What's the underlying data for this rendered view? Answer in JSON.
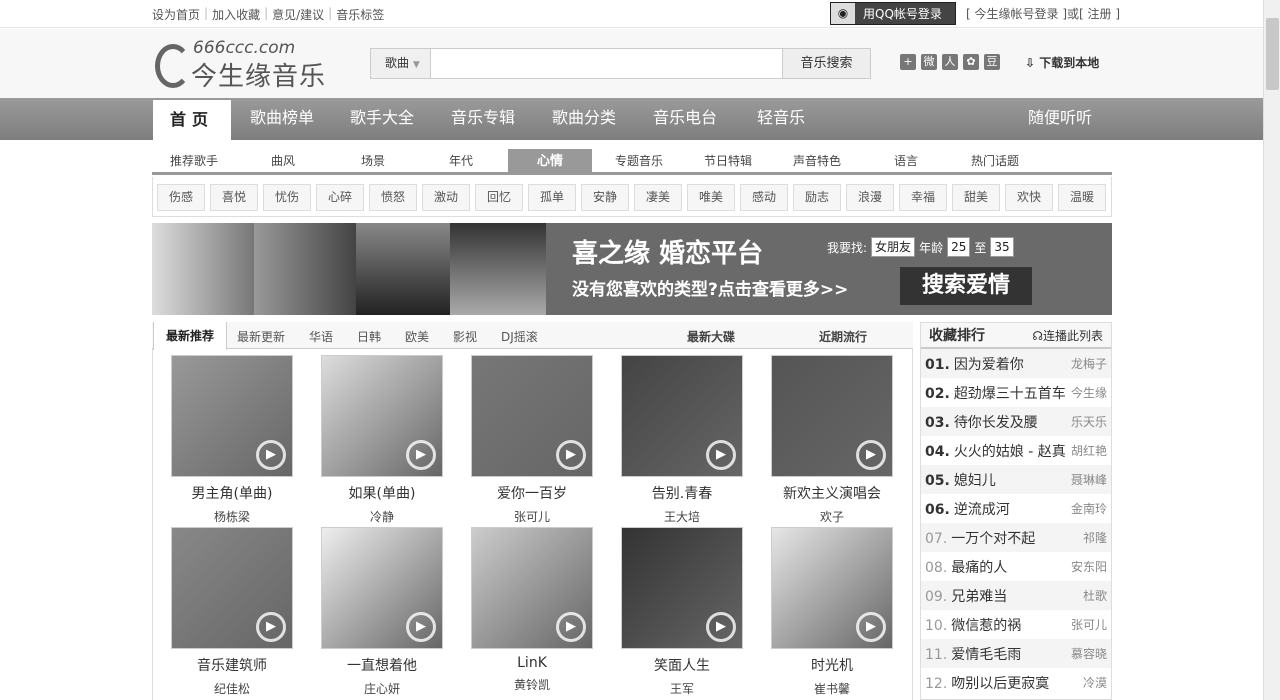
{
  "topbar": {
    "links": [
      "设为首页",
      "加入收藏",
      "意见/建议",
      "音乐标签"
    ],
    "qq_login": "用QQ帐号登录",
    "account_login": "今生缘帐号登录",
    "or": "或",
    "register": "注册"
  },
  "logo": {
    "domain": "666ccc.com",
    "name": "今生缘音乐"
  },
  "search": {
    "category": "歌曲",
    "placeholder": "",
    "button": "音乐搜索"
  },
  "share_icons": [
    "plus-icon",
    "weibo-icon",
    "renren-icon",
    "baidu-icon",
    "douban-icon"
  ],
  "download": "下载到本地",
  "nav": [
    "首页",
    "歌曲榜单",
    "歌手大全",
    "音乐专辑",
    "歌曲分类",
    "音乐电台",
    "轻音乐",
    "随便听听"
  ],
  "subnav": [
    "推荐歌手",
    "曲风",
    "场景",
    "年代",
    "心情",
    "专题音乐",
    "节日特辑",
    "声音特色",
    "语言",
    "热门话题"
  ],
  "moods": [
    "伤感",
    "喜悦",
    "忧伤",
    "心碎",
    "愤怒",
    "激动",
    "回忆",
    "孤单",
    "安静",
    "凄美",
    "唯美",
    "感动",
    "励志",
    "浪漫",
    "幸福",
    "甜美",
    "欢快",
    "温暖"
  ],
  "banner": {
    "title": "喜之缘 婚恋平台",
    "subtitle": "没有您喜欢的类型?点击查看更多>>",
    "find_label": "我要找:",
    "find_value": "女朋友",
    "age_label": "年龄",
    "age_from": "25",
    "to": "至",
    "age_to": "35",
    "button": "搜索爱情"
  },
  "tabs": [
    "最新推荐",
    "最新更新",
    "华语",
    "日韩",
    "欧美",
    "影视",
    "DJ摇滚"
  ],
  "right_tabs": [
    "最新大碟",
    "近期流行"
  ],
  "albums": [
    {
      "title": "男主角(单曲)",
      "artist": "杨栋梁"
    },
    {
      "title": "如果(单曲)",
      "artist": "冷静"
    },
    {
      "title": "爱你一百岁",
      "artist": "张可儿"
    },
    {
      "title": "告别.青春",
      "artist": "王大培"
    },
    {
      "title": "新欢主义演唱会",
      "artist": "欢子"
    },
    {
      "title": "音乐建筑师",
      "artist": "纪佳松"
    },
    {
      "title": "一直想着他",
      "artist": "庄心妍"
    },
    {
      "title": "LinK",
      "artist": "黄铃凯"
    },
    {
      "title": "笑面人生",
      "artist": "王军"
    },
    {
      "title": "时光机",
      "artist": "崔书馨"
    }
  ],
  "rank": {
    "title": "收藏排行",
    "play_all": "连播此列表",
    "items": [
      {
        "n": "01.",
        "song": "因为爱着你",
        "artist": "龙梅子"
      },
      {
        "n": "02.",
        "song": "超劲爆三十五首车",
        "artist": "今生缘"
      },
      {
        "n": "03.",
        "song": "待你长发及腰",
        "artist": "乐天乐"
      },
      {
        "n": "04.",
        "song": "火火的姑娘 - 赵真",
        "artist": "胡红艳"
      },
      {
        "n": "05.",
        "song": "媳妇儿",
        "artist": "聂琳峰"
      },
      {
        "n": "06.",
        "song": "逆流成河",
        "artist": "金南玲"
      },
      {
        "n": "07.",
        "song": "一万个对不起",
        "artist": "祁隆"
      },
      {
        "n": "08.",
        "song": "最痛的人",
        "artist": "安东阳"
      },
      {
        "n": "09.",
        "song": "兄弟难当",
        "artist": "杜歌"
      },
      {
        "n": "10.",
        "song": "微信惹的祸",
        "artist": "张可儿"
      },
      {
        "n": "11.",
        "song": "爱情毛毛雨",
        "artist": "慕容晓"
      },
      {
        "n": "12.",
        "song": "吻别以后更寂寞",
        "artist": "冷漠"
      }
    ]
  }
}
